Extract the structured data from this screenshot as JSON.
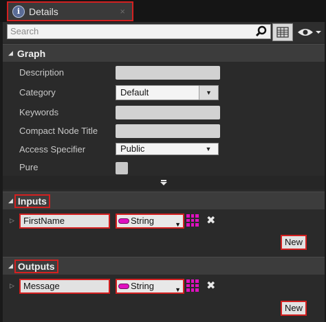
{
  "tab": {
    "title": "Details",
    "icon": "info-icon",
    "close": "×"
  },
  "search": {
    "placeholder": "Search"
  },
  "graph": {
    "title": "Graph",
    "rows": {
      "description": {
        "label": "Description",
        "value": ""
      },
      "category": {
        "label": "Category",
        "value": "Default"
      },
      "keywords": {
        "label": "Keywords",
        "value": ""
      },
      "compact": {
        "label": "Compact Node Title",
        "value": ""
      },
      "access": {
        "label": "Access Specifier",
        "value": "Public"
      },
      "pure": {
        "label": "Pure",
        "checked": false
      }
    }
  },
  "inputs": {
    "title": "Inputs",
    "params": [
      {
        "name": "FirstName",
        "type": "String"
      }
    ],
    "new_label": "New"
  },
  "outputs": {
    "title": "Outputs",
    "params": [
      {
        "name": "Message",
        "type": "String"
      }
    ],
    "new_label": "New"
  },
  "colors": {
    "highlight": "#d42020",
    "string_pin": "#e010c0",
    "panel_bg": "#2a2a2a",
    "header_bg": "#3c3c3c"
  }
}
